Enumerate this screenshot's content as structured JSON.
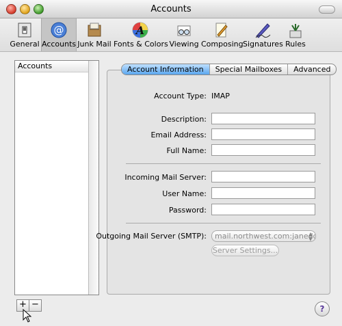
{
  "window": {
    "title": "Accounts"
  },
  "toolbar": {
    "items": [
      {
        "label": "General",
        "icon": "general-switch-icon"
      },
      {
        "label": "Accounts",
        "icon": "at-sign-icon",
        "selected": true
      },
      {
        "label": "Junk Mail",
        "icon": "junk-mail-icon"
      },
      {
        "label": "Fonts & Colors",
        "icon": "fonts-colors-icon"
      },
      {
        "label": "Viewing",
        "icon": "viewing-glasses-icon"
      },
      {
        "label": "Composing",
        "icon": "composing-pencil-icon"
      },
      {
        "label": "Signatures",
        "icon": "signature-pen-icon"
      },
      {
        "label": "Rules",
        "icon": "rules-icon"
      }
    ]
  },
  "accounts_list": {
    "header": "Accounts",
    "add_label": "+",
    "remove_label": "−"
  },
  "tabs": [
    {
      "label": "Account Information",
      "active": true
    },
    {
      "label": "Special Mailboxes",
      "active": false
    },
    {
      "label": "Advanced",
      "active": false
    }
  ],
  "form": {
    "account_type_label": "Account Type:",
    "account_type_value": "IMAP",
    "description_label": "Description:",
    "email_label": "Email Address:",
    "fullname_label": "Full Name:",
    "incoming_label": "Incoming Mail Server:",
    "username_label": "User Name:",
    "password_label": "Password:",
    "smtp_label": "Outgoing Mail Server (SMTP):",
    "smtp_value": "mail.northwest.com:janedoe",
    "server_settings_label": "Server Settings..."
  },
  "help": {
    "label": "?"
  },
  "colors": {
    "tab_active": "#5aa6ee",
    "disabled_text": "#999999"
  }
}
